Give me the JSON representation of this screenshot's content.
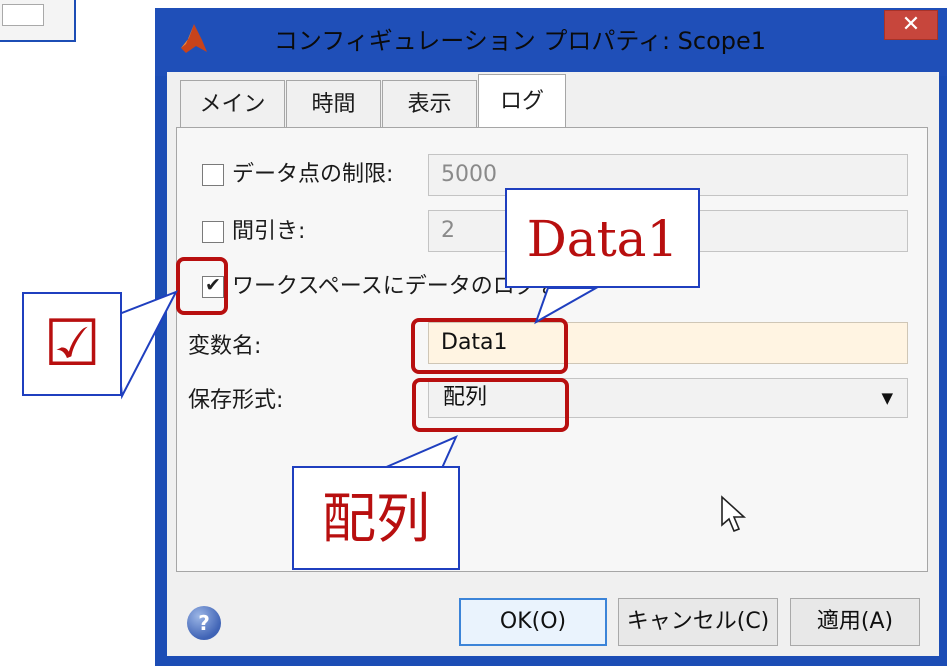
{
  "dialog": {
    "title": "コンフィギュレーション プロパティ: Scope1",
    "close_label": "✕",
    "tabs": [
      {
        "label": "メイン"
      },
      {
        "label": "時間"
      },
      {
        "label": "表示"
      },
      {
        "label": "ログ",
        "active": true
      }
    ]
  },
  "log_tab": {
    "limit_data_points": {
      "label": "データ点の制限:",
      "checked": false,
      "value": "5000"
    },
    "decimation": {
      "label": "間引き:",
      "checked": false,
      "value": "2"
    },
    "log_to_workspace": {
      "label": "ワークスペースにデータのログを",
      "checked": true
    },
    "variable_name": {
      "label": "変数名:",
      "value": "Data1"
    },
    "save_format": {
      "label": "保存形式:",
      "value": "配列"
    }
  },
  "buttons": {
    "ok": "OK(O)",
    "cancel": "キャンセル(C)",
    "apply": "適用(A)",
    "help": "?"
  },
  "annotations": {
    "checkbox_callout": "☑",
    "data1_callout": "Data1",
    "format_callout": "配列"
  },
  "colors": {
    "title_bar": "#1f4fb8",
    "close_button": "#c7463c",
    "highlight": "#b80f0f",
    "callout_border": "#1f3fbf",
    "editable_field": "#fff4e2"
  },
  "icons": [
    "matlab-logo-icon",
    "close-icon",
    "checkbox-icon",
    "dropdown-arrow-icon",
    "help-icon",
    "mouse-cursor-icon"
  ]
}
